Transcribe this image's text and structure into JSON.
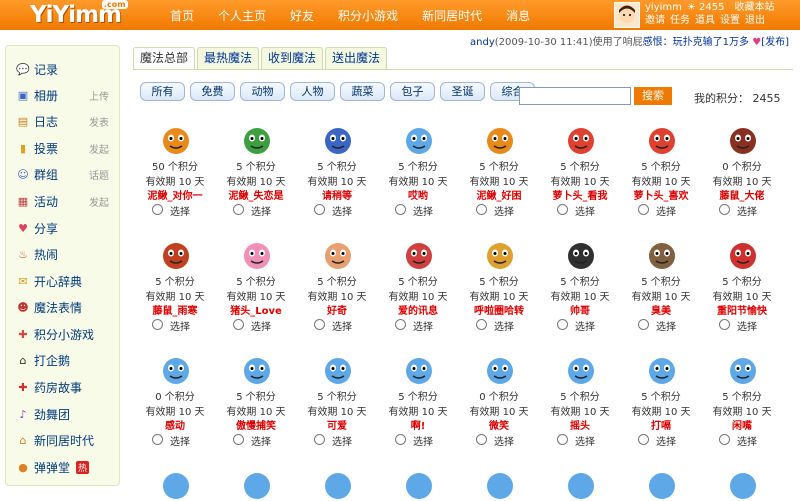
{
  "header": {
    "logo": "YiYimm",
    "logo_suffix": ".com",
    "nav": [
      "首页",
      "个人主页",
      "好友",
      "积分小游戏",
      "新同居时代",
      "消息"
    ],
    "user": {
      "name": "yiyimm",
      "points_badge": "2455",
      "links_top": [
        "收藏本站"
      ],
      "links_bottom": [
        "邀请",
        "任务",
        "道具",
        "设置",
        "退出"
      ]
    }
  },
  "sidebar": {
    "items": [
      {
        "label": "记录",
        "icon": "speech-bubble-icon",
        "sub": ""
      },
      {
        "label": "相册",
        "icon": "photo-icon",
        "sub": "上传"
      },
      {
        "label": "日志",
        "icon": "notebook-icon",
        "sub": "发表"
      },
      {
        "label": "投票",
        "icon": "bar-chart-icon",
        "sub": "发起"
      },
      {
        "label": "群组",
        "icon": "group-icon",
        "sub": "话题"
      },
      {
        "label": "活动",
        "icon": "calendar-icon",
        "sub": "发起"
      },
      {
        "label": "分享",
        "icon": "share-icon",
        "sub": ""
      },
      {
        "label": "热闹",
        "icon": "fire-icon",
        "sub": ""
      },
      {
        "label": "开心辞典",
        "icon": "book-icon",
        "sub": ""
      },
      {
        "label": "魔法表情",
        "icon": "magic-face-icon",
        "sub": ""
      },
      {
        "label": "积分小游戏",
        "icon": "gamepad-icon",
        "sub": ""
      },
      {
        "label": "打企鹅",
        "icon": "penguin-icon",
        "sub": ""
      },
      {
        "label": "药房故事",
        "icon": "pharmacy-icon",
        "sub": ""
      },
      {
        "label": "劲舞团",
        "icon": "dance-icon",
        "sub": ""
      },
      {
        "label": "新同居时代",
        "icon": "house-icon",
        "sub": ""
      },
      {
        "label": "弹弹堂",
        "icon": "bomb-icon",
        "sub": "",
        "badge": "热"
      }
    ]
  },
  "breadcrumb": {
    "user": "andy",
    "time": "(2009-10-30 11:41)",
    "used": "使用了",
    "item": "响屁",
    "item_link": "感恨",
    "message": "：玩扑克输了1万多",
    "heart_icon": "heart-icon",
    "publish": "[发布]"
  },
  "tabs": [
    "魔法总部",
    "最热魔法",
    "收到魔法",
    "送出魔法"
  ],
  "categories": [
    "所有",
    "免费",
    "动物",
    "人物",
    "蔬菜",
    "包子",
    "圣诞",
    "综合"
  ],
  "search": {
    "placeholder": "",
    "button": "搜索"
  },
  "my_points": {
    "label": "我的积分：",
    "value": "2455"
  },
  "labels": {
    "points_suffix": "个积分",
    "validity": "有效期",
    "days": "天",
    "select": "选择"
  },
  "items": [
    {
      "name": "泥鳅_对你一",
      "points": "50",
      "days": "10",
      "color": "#e88a1a"
    },
    {
      "name": "泥鳅_失恋是",
      "points": "5",
      "days": "10",
      "color": "#3ca040"
    },
    {
      "name": "请稍等",
      "points": "5",
      "days": "10",
      "color": "#3a66c4"
    },
    {
      "name": "哎哟",
      "points": "5",
      "days": "10",
      "color": "#5ea8e8"
    },
    {
      "name": "泥鳅_好困",
      "points": "5",
      "days": "10",
      "color": "#e88a1a"
    },
    {
      "name": "萝卜头_看我",
      "points": "5",
      "days": "10",
      "color": "#e04030"
    },
    {
      "name": "萝卜头_喜欢",
      "points": "5",
      "days": "10",
      "color": "#e04030"
    },
    {
      "name": "藤鼠_大佬",
      "points": "0",
      "days": "10",
      "color": "#8a3020"
    },
    {
      "name": "藤鼠_雨寒",
      "points": "5",
      "days": "10",
      "color": "#c04020"
    },
    {
      "name": "猪头_Love",
      "points": "5",
      "days": "10",
      "color": "#f090b8"
    },
    {
      "name": "好奇",
      "points": "5",
      "days": "10",
      "color": "#e8a070"
    },
    {
      "name": "爱的讯息",
      "points": "5",
      "days": "10",
      "color": "#d04040"
    },
    {
      "name": "呼啦圈哈转",
      "points": "5",
      "days": "10",
      "color": "#e0a030"
    },
    {
      "name": "帅哥",
      "points": "5",
      "days": "10",
      "color": "#303030"
    },
    {
      "name": "臭美",
      "points": "5",
      "days": "10",
      "color": "#806040"
    },
    {
      "name": "重阳节愉快",
      "points": "5",
      "days": "10",
      "color": "#d03030"
    },
    {
      "name": "感动",
      "points": "0",
      "days": "10",
      "color": "#5ea8e8"
    },
    {
      "name": "傲慢捕笑",
      "points": "5",
      "days": "10",
      "color": "#5ea8e8"
    },
    {
      "name": "可爱",
      "points": "5",
      "days": "10",
      "color": "#5ea8e8"
    },
    {
      "name": "啊!",
      "points": "5",
      "days": "10",
      "color": "#5ea8e8"
    },
    {
      "name": "微笑",
      "points": "0",
      "days": "10",
      "color": "#5ea8e8"
    },
    {
      "name": "摇头",
      "points": "5",
      "days": "10",
      "color": "#5ea8e8"
    },
    {
      "name": "打嗝",
      "points": "5",
      "days": "10",
      "color": "#5ea8e8"
    },
    {
      "name": "闲嘴",
      "points": "5",
      "days": "10",
      "color": "#5ea8e8"
    }
  ]
}
